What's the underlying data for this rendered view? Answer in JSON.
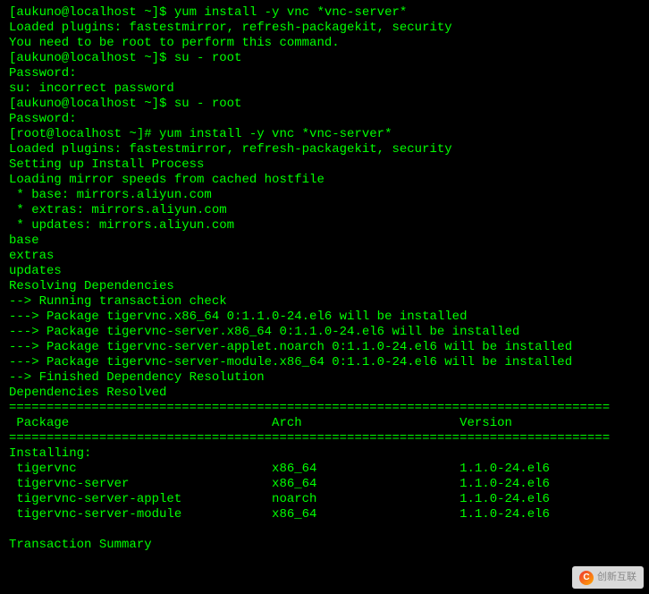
{
  "lines": {
    "l1": "[aukuno@localhost ~]$ yum install -y vnc *vnc-server*",
    "l2": "Loaded plugins: fastestmirror, refresh-packagekit, security",
    "l3": "You need to be root to perform this command.",
    "l4": "[aukuno@localhost ~]$ su - root",
    "l5": "Password:",
    "l6": "su: incorrect password",
    "l7": "[aukuno@localhost ~]$ su - root",
    "l8": "Password:",
    "l9": "[root@localhost ~]# yum install -y vnc *vnc-server*",
    "l10": "Loaded plugins: fastestmirror, refresh-packagekit, security",
    "l11": "Setting up Install Process",
    "l12": "Loading mirror speeds from cached hostfile",
    "l13": " * base: mirrors.aliyun.com",
    "l14": " * extras: mirrors.aliyun.com",
    "l15": " * updates: mirrors.aliyun.com",
    "l16": "base",
    "l17": "extras",
    "l18": "updates",
    "l19": "Resolving Dependencies",
    "l20": "--> Running transaction check",
    "l21": "---> Package tigervnc.x86_64 0:1.1.0-24.el6 will be installed",
    "l22": "---> Package tigervnc-server.x86_64 0:1.1.0-24.el6 will be installed",
    "l23": "---> Package tigervnc-server-applet.noarch 0:1.1.0-24.el6 will be installed",
    "l24": "---> Package tigervnc-server-module.x86_64 0:1.1.0-24.el6 will be installed",
    "l25": "--> Finished Dependency Resolution",
    "l26": "",
    "l27": "Dependencies Resolved",
    "l28": "",
    "divider": "================================================================================",
    "header": " Package                           Arch                     Version",
    "install_label": "Installing:",
    "summary": "Transaction Summary"
  },
  "packages": [
    {
      "name": "tigervnc",
      "arch": "x86_64",
      "version": "1.1.0-24.el6"
    },
    {
      "name": "tigervnc-server",
      "arch": "x86_64",
      "version": "1.1.0-24.el6"
    },
    {
      "name": "tigervnc-server-applet",
      "arch": "noarch",
      "version": "1.1.0-24.el6"
    },
    {
      "name": "tigervnc-server-module",
      "arch": "x86_64",
      "version": "1.1.0-24.el6"
    }
  ],
  "watermark_text": "创新互联"
}
